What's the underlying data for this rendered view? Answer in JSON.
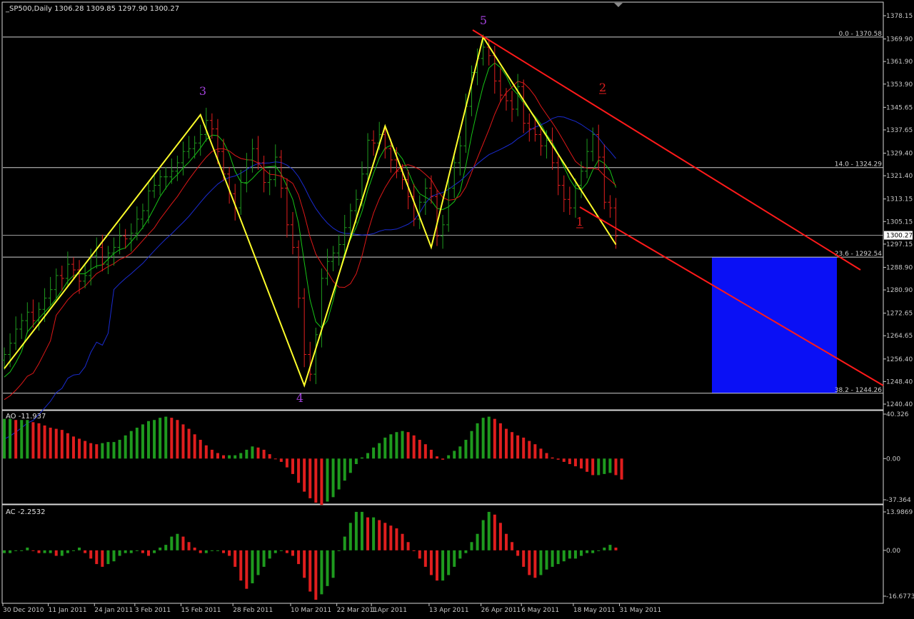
{
  "header": {
    "main": "_SP500,Daily  1306.28 1309.85 1297.90 1300.27",
    "ao": "AO -11.937",
    "ac": "AC -2.2532"
  },
  "colors": {
    "up": "#1e9a1e",
    "down": "#e01e1e",
    "ma_fast": "#16c416",
    "ma_mid": "#dd1818",
    "ma_slow": "#1a2bd0",
    "zigzag": "#ffff2a",
    "channel": "#ff1a1a",
    "zone": "#0a10f5",
    "wave_purple": "#a040d8",
    "wave_red": "#e01e1e"
  },
  "chart_data": [
    {
      "type": "candlestick",
      "title": "_SP500,Daily",
      "ohlc_last": {
        "open": 1306.28,
        "high": 1309.85,
        "low": 1297.9,
        "close": 1300.27
      },
      "x_labels": [
        "30 Dec 2010",
        "11 Jan 2011",
        "24 Jan 2011",
        "3 Feb 2011",
        "15 Feb 2011",
        "28 Feb 2011",
        "10 Mar 2011",
        "22 Mar 2011",
        "1 Apr 2011",
        "13 Apr 2011",
        "26 Apr 2011",
        "6 May 2011",
        "18 May 2011",
        "31 May 2011"
      ],
      "y_ticks": [
        "1378.15",
        "1369.90",
        "1361.90",
        "1353.90",
        "1345.65",
        "1337.65",
        "1329.40",
        "1321.40",
        "1313.15",
        "1305.15",
        "1297.15",
        "1288.90",
        "1280.90",
        "1272.65",
        "1264.65",
        "1256.40",
        "1248.40",
        "1240.40"
      ],
      "ylim": [
        1237,
        1383
      ],
      "current_price": "1300.27",
      "closes": [
        1258,
        1262,
        1267,
        1270,
        1273,
        1270,
        1274,
        1278,
        1281,
        1286,
        1285,
        1290,
        1288,
        1284,
        1286,
        1293,
        1296,
        1290,
        1294,
        1296,
        1300,
        1299,
        1301,
        1306,
        1309,
        1316,
        1318,
        1321,
        1321,
        1323,
        1326,
        1330,
        1331,
        1333,
        1336,
        1341,
        1338,
        1330,
        1322,
        1315,
        1310,
        1319,
        1327,
        1331,
        1326,
        1319,
        1320,
        1328,
        1317,
        1304,
        1296,
        1278,
        1258,
        1251,
        1265,
        1285,
        1291,
        1294,
        1297,
        1303,
        1309,
        1313,
        1322,
        1334,
        1333,
        1336,
        1331,
        1327,
        1323,
        1320,
        1314,
        1306,
        1312,
        1317,
        1314,
        1300,
        1304,
        1317,
        1326,
        1332,
        1346,
        1358,
        1363,
        1367,
        1364,
        1355,
        1350,
        1348,
        1345,
        1353,
        1340,
        1338,
        1336,
        1332,
        1334,
        1326,
        1318,
        1313,
        1310,
        1318,
        1323,
        1330,
        1336,
        1328,
        1312,
        1310,
        1300
      ],
      "fib_levels": [
        {
          "label": "0.0 - 1370.58",
          "price": 1370.58
        },
        {
          "label": "14.0 - 1324.29",
          "price": 1324.29
        },
        {
          "label": "23.6 - 1292.54",
          "price": 1292.54
        },
        {
          "label": "38.2 - 1244.26",
          "price": 1244.26
        }
      ],
      "wave_labels": [
        {
          "text": "3",
          "color": "wave_purple"
        },
        {
          "text": "4",
          "color": "wave_purple"
        },
        {
          "text": "5",
          "color": "wave_purple"
        },
        {
          "text": "1",
          "color": "wave_red"
        },
        {
          "text": "2",
          "color": "wave_red"
        }
      ],
      "zigzag": [
        {
          "bar": 0,
          "price": 1253
        },
        {
          "bar": 34,
          "price": 1343
        },
        {
          "bar": 52,
          "price": 1247
        },
        {
          "bar": 66,
          "price": 1339
        },
        {
          "bar": 74,
          "price": 1296
        },
        {
          "bar": 83,
          "price": 1370.58
        },
        {
          "bar": 106,
          "price": 1297
        }
      ],
      "target_zone": {
        "price_top": 1292.54,
        "price_bottom": 1244.26
      }
    },
    {
      "type": "bar",
      "title": "AO -11.937",
      "y_ticks": [
        "40.326",
        "0.00",
        "-37.364"
      ],
      "ylim": [
        -37.364,
        40.326
      ],
      "values": [
        36,
        36,
        35,
        35,
        35,
        33,
        32,
        30,
        28,
        27,
        26,
        23,
        20,
        18,
        16,
        14,
        13,
        14,
        15,
        15,
        17,
        21,
        25,
        28,
        31,
        34,
        35,
        37,
        38,
        37,
        35,
        31,
        27,
        22,
        17,
        12,
        8,
        5,
        3,
        3,
        3,
        5,
        8,
        11,
        10,
        8,
        4,
        0,
        -3,
        -8,
        -14,
        -22,
        -30,
        -36,
        -40,
        -42,
        -39,
        -35,
        -28,
        -20,
        -13,
        -5,
        1,
        5,
        10,
        14,
        19,
        22,
        24,
        25,
        24,
        21,
        17,
        13,
        8,
        2,
        -1,
        3,
        7,
        11,
        17,
        25,
        32,
        37,
        38,
        36,
        32,
        27,
        24,
        21,
        19,
        16,
        13,
        9,
        5,
        1,
        -1,
        -3,
        -5,
        -7,
        -9,
        -12,
        -15,
        -15,
        -14,
        -13,
        -15,
        -19
      ]
    },
    {
      "type": "bar",
      "title": "AC -2.2532",
      "y_ticks": [
        "13.9869",
        "0.00",
        "-16.6773"
      ],
      "ylim": [
        -16.6773,
        13.9869
      ],
      "values": [
        -1,
        -1,
        0,
        0,
        1,
        0,
        -1,
        -1,
        -1,
        -2,
        -2,
        -1,
        0,
        1,
        -1,
        -3,
        -5,
        -6,
        -5,
        -4,
        -2,
        -1,
        -1,
        0,
        -1,
        -2,
        -1,
        1,
        2,
        5,
        6,
        5,
        3,
        1,
        -1,
        -1,
        0,
        0,
        -1,
        -2,
        -6,
        -11,
        -14,
        -12,
        -9,
        -6,
        -3,
        -1,
        0,
        -1,
        -2,
        -5,
        -10,
        -15,
        -18,
        -16,
        -13,
        -10,
        0,
        5,
        10,
        14,
        14,
        12,
        12,
        11,
        10,
        9,
        8,
        6,
        3,
        0,
        -3,
        -6,
        -9,
        -11,
        -11,
        -9,
        -6,
        -3,
        -1,
        3,
        6,
        11,
        14,
        13,
        10,
        6,
        3,
        -2,
        -6,
        -9,
        -10,
        -9,
        -7,
        -6,
        -5,
        -4,
        -3,
        -3,
        -2,
        -1,
        -1,
        0,
        1,
        2,
        1
      ]
    }
  ]
}
